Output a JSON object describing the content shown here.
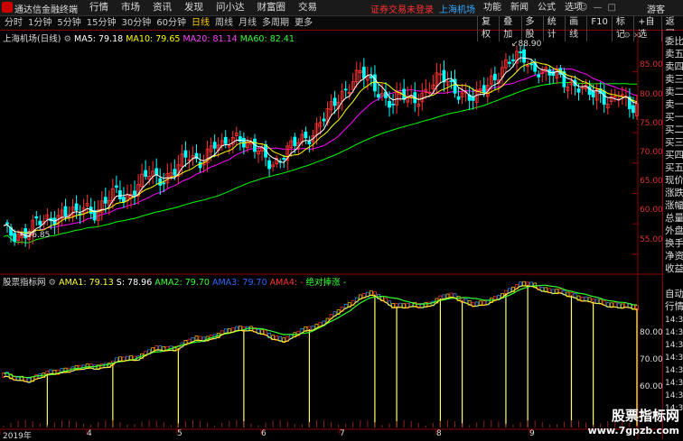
{
  "titlebar": {
    "app_name": "通达信金融终端",
    "menu": [
      "行情",
      "市场",
      "资讯",
      "发现",
      "问小达",
      "财富圈",
      "交易"
    ],
    "notice_red": "证券交易未登录",
    "notice_blue": "上海机场",
    "controls": [
      "功能",
      "新闻",
      "公式",
      "选项"
    ],
    "guest": "游客"
  },
  "toolbar": {
    "periods": [
      "分时",
      "1分钟",
      "5分钟",
      "15分钟",
      "30分钟",
      "60分钟",
      "日线",
      "周线",
      "月线",
      "多周期",
      "更多"
    ],
    "active_period": "日线",
    "tools": [
      "复权",
      "叠加",
      "多股",
      "统计",
      "画线",
      "F10",
      "标记",
      "+自选",
      "返回"
    ]
  },
  "main_chart": {
    "stock_label": "上海机场(日线)",
    "ma5_label": "MA5: 79.18",
    "ma10_label": "MA10: 79.65",
    "ma20_label": "MA20: 81.14",
    "ma60_label": "MA60: 82.41",
    "high_label": "88.90",
    "low_label": "56.85",
    "colors": {
      "ma5": "#ffffff",
      "ma10": "#ffff00",
      "ma20": "#ff00ff",
      "ma60": "#00ff00",
      "up": "#ff3333",
      "down": "#00ffff"
    }
  },
  "sub_chart": {
    "label": "股票指标网",
    "ama1_label": "AMA1: 79.13",
    "s_label": "S: 78.96",
    "ama2_label": "AMA2: 79.70",
    "ama3_label": "AMA3: 79.70",
    "ama4_label": "AMA4: -",
    "extra_label": "绝对捧涨 -",
    "auto_label": "自动"
  },
  "x_axis": {
    "year": "2019年",
    "months": [
      "4",
      "5",
      "6",
      "7",
      "8",
      "9"
    ]
  },
  "right_panel": [
    "委比",
    "卖五",
    "卖四",
    "卖三",
    "卖二",
    "卖一",
    "买一",
    "买二",
    "买三",
    "买四",
    "买五",
    "现价",
    "涨跌",
    "涨幅",
    "总量",
    "外盘",
    "换手",
    "净资",
    "收益",
    "行情"
  ],
  "right_axis_top": [
    "85.00",
    "80.00",
    "75.00",
    "70.00",
    "65.00",
    "60.00",
    "55.00"
  ],
  "right_axis_bottom": [
    "80.00",
    "70.00",
    "60.00",
    "50.00"
  ],
  "right_times": [
    "14:30",
    "14:30",
    "14:30",
    "14:30",
    "14:30",
    "14:30",
    "14:31",
    "14:31"
  ],
  "watermark": {
    "line1": "股票指标网",
    "line2": "www.7gpzb.com"
  },
  "chart_data": [
    {
      "type": "candlestick",
      "title": "上海机场(日线)",
      "ylim": [
        52,
        90
      ],
      "x_months": [
        "4",
        "5",
        "6",
        "7",
        "8",
        "9"
      ],
      "close_approx": [
        59,
        58,
        58.5,
        59,
        60,
        60,
        61,
        62,
        62,
        61,
        63,
        62,
        63,
        64,
        65,
        64,
        66,
        67,
        68,
        67,
        68,
        69,
        70,
        71,
        70,
        72,
        73,
        72,
        74,
        75,
        73,
        72,
        71,
        70,
        71,
        72,
        73,
        74,
        75,
        77,
        78,
        80,
        82,
        84,
        85,
        83,
        82,
        81,
        80,
        81,
        80,
        81,
        82,
        83,
        84,
        83,
        82,
        81,
        80,
        82,
        84,
        85,
        86,
        87,
        88,
        86,
        85,
        84,
        85,
        84,
        83,
        82,
        81,
        82,
        81,
        80,
        81,
        79,
        80
      ],
      "annotations": [
        {
          "text": "88.90",
          "kind": "high"
        },
        {
          "text": "56.85",
          "kind": "low"
        }
      ],
      "series": [
        {
          "name": "MA5",
          "last": 79.18
        },
        {
          "name": "MA10",
          "last": 79.65
        },
        {
          "name": "MA20",
          "last": 81.14
        },
        {
          "name": "MA60",
          "last": 82.41
        }
      ]
    },
    {
      "type": "line",
      "title": "股票指标网",
      "ylim": [
        44,
        87
      ],
      "series": [
        {
          "name": "AMA1",
          "last": 79.13
        },
        {
          "name": "S",
          "last": 78.96
        },
        {
          "name": "AMA2",
          "last": 79.7
        },
        {
          "name": "AMA3",
          "last": 79.7
        }
      ]
    }
  ]
}
